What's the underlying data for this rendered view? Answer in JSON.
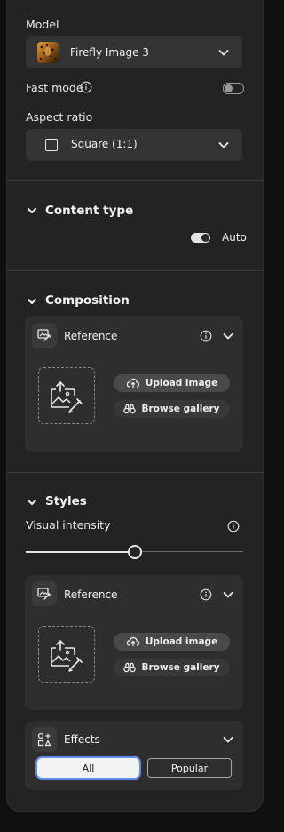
{
  "model": {
    "label": "Model",
    "selected": "Firefly Image 3"
  },
  "fast_mode": {
    "label": "Fast mode",
    "enabled": false
  },
  "aspect_ratio": {
    "label": "Aspect ratio",
    "selected": "Square (1:1)"
  },
  "content_type": {
    "title": "Content type",
    "toggle_label": "Auto",
    "auto_enabled": true
  },
  "composition": {
    "title": "Composition",
    "reference": {
      "label": "Reference",
      "upload_label": "Upload image",
      "browse_label": "Browse gallery"
    }
  },
  "styles": {
    "title": "Styles",
    "visual_intensity": {
      "label": "Visual intensity",
      "value_fraction": 0.5
    },
    "reference": {
      "label": "Reference",
      "upload_label": "Upload image",
      "browse_label": "Browse gallery"
    },
    "effects": {
      "label": "Effects",
      "tabs": [
        "All",
        "Popular"
      ],
      "active_tab": "All"
    }
  },
  "colors": {
    "panel_bg": "#232323",
    "subpanel_bg": "#2e2e2e",
    "focus_ring": "#5b8def",
    "text": "#ececec"
  }
}
